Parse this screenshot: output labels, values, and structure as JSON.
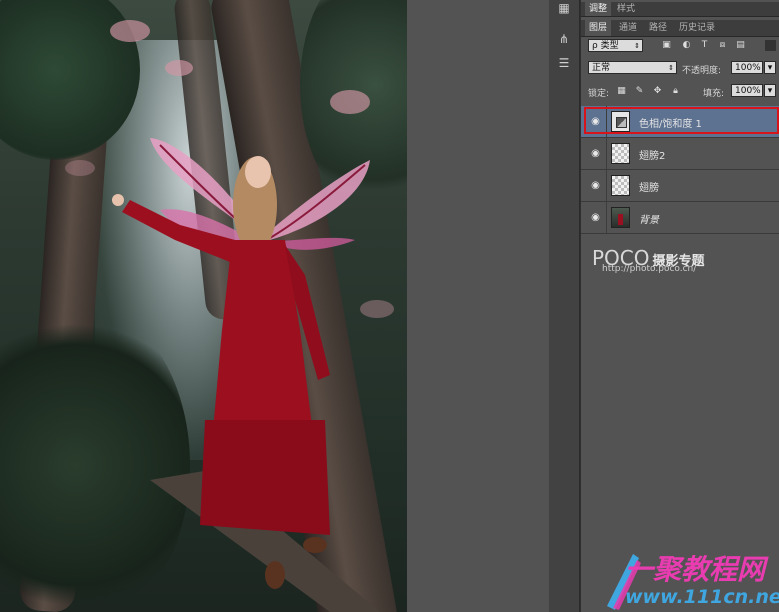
{
  "panel_tabs_top": {
    "adjust": "调整",
    "style": "样式"
  },
  "panel_tabs": [
    "图层",
    "通道",
    "路径",
    "历史记录"
  ],
  "filter": {
    "kind_label": "ρ 类型"
  },
  "blend": {
    "mode": "正常",
    "opacity_label": "不透明度:",
    "opacity_value": "100%"
  },
  "lock": {
    "label": "锁定:",
    "fill_label": "填充:",
    "fill_value": "100%"
  },
  "layers": [
    {
      "name": "色相/饱和度 1",
      "thumb": "adjustment",
      "selected": true
    },
    {
      "name": "翅膀2",
      "thumb": "transparent",
      "selected": false
    },
    {
      "name": "翅膀",
      "thumb": "transparent",
      "selected": false
    },
    {
      "name": "背景",
      "thumb": "photo",
      "selected": false
    }
  ],
  "watermark_poco": {
    "logo": "POCO",
    "tagline": "摄影专题",
    "url": "http://photo.poco.cn/"
  },
  "watermark_site": {
    "name": "一聚教程网",
    "url": "www.111cn.net"
  },
  "colors": {
    "selection_highlight": "#d8141a",
    "selected_layer": "#5d7190",
    "dress": "#9c0f1f",
    "wing": "#e8a6c8",
    "site_pink": "#e83cb0",
    "site_blue": "#3fa6e0"
  },
  "icons": {
    "eye": "eye-icon",
    "lock": "lock-icon",
    "move": "move-icon",
    "brush": "brush-icon"
  }
}
